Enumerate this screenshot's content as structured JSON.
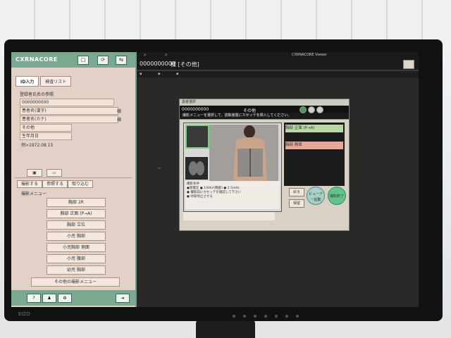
{
  "monitor": {
    "brand": "EIZO"
  },
  "left_panel": {
    "logo": "CXRNACORE",
    "header_icons": [
      "□",
      "⟳",
      "⇆"
    ],
    "tabs": [
      "ID入力",
      "検査リスト"
    ],
    "section_label": "登録者氏名の参照",
    "patient_id_value": "0000000000",
    "name_kanji_placeholder": "患者名(漢字)",
    "name_kana_placeholder": "患者名(カナ)",
    "sama_1": "様",
    "sama_2": "様",
    "other_label": "その他",
    "dob_label": "生年月日",
    "dob_example": "例>1972.08.15",
    "action_tabs": [
      "撮影する",
      "参照する",
      "取り込む"
    ],
    "menu_label": "撮影メニュー",
    "menu_items": [
      "胸部 2R",
      "胸部 正面 (P→A)",
      "胸部 立位",
      "小児 胸部",
      "小児胸部 側面",
      "小児 腹部",
      "幼児 胸部"
    ],
    "other_menu": "その他の撮影メニュー"
  },
  "top_bar": {
    "patient_id": "0000000000",
    "patient_suffix": "様 [その他]",
    "app_title": "CXRNACORE Viewer"
  },
  "dialog": {
    "title": "患者選択",
    "patient_id": "0000000000",
    "patient_name": "その他",
    "message": "撮影メニューを選択して、読取装置にカセッテを挿入してください。",
    "selected_item_1": "胸部 正面 (P→A)",
    "selected_item_2": "胸部 側面",
    "notes": [
      "撮影条件",
      "●管電圧 ● 100kV(胸部) ● 2.5mAs",
      "● 撮影前にカセッテを確認して下さい",
      "● 呼吸停止させる"
    ],
    "side_btn_1": "戻る",
    "side_btn_2": "保留",
    "btn_viewer": "ビューアー起動",
    "btn_finish": "撮影終了"
  }
}
